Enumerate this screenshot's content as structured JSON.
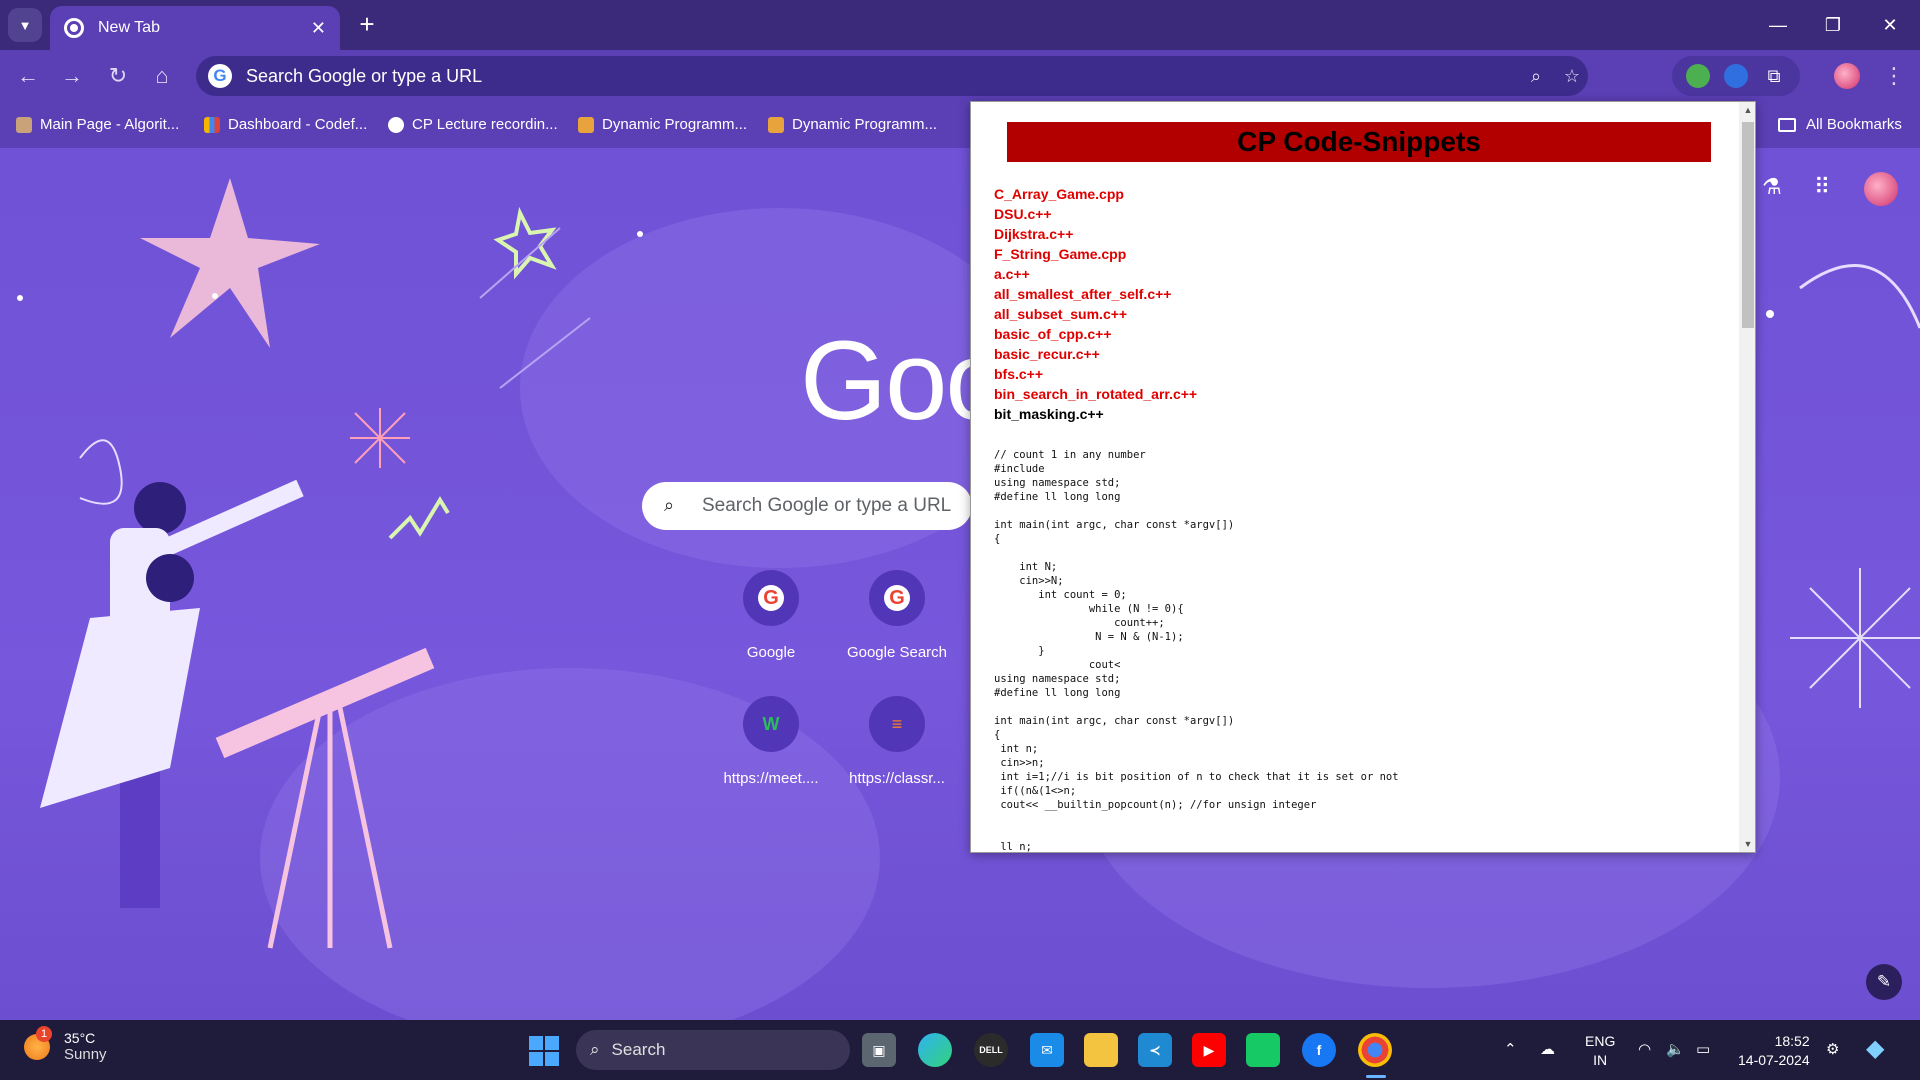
{
  "browser": {
    "tab_title": "New Tab",
    "omnibox_placeholder": "Search Google or type a URL",
    "bookmarks": [
      "Main Page - Algorit...",
      "Dashboard - Codef...",
      "CP Lecture recordin...",
      "Dynamic Programm...",
      "Dynamic Programm..."
    ],
    "all_bookmarks": "All Bookmarks"
  },
  "ntp": {
    "logo_text": "Goo",
    "search_placeholder": "Search Google or type a URL",
    "shortcuts": [
      {
        "label": "Google",
        "icon": "google-icon"
      },
      {
        "label": "Google Search",
        "icon": "google-icon"
      },
      {
        "label": "https://meet....",
        "icon": "w-icon"
      },
      {
        "label": "https://classr...",
        "icon": "stackoverflow-icon"
      }
    ]
  },
  "popup": {
    "title": "CP Code-Snippets",
    "files": [
      "C_Array_Game.cpp",
      "DSU.c++",
      "Dijkstra.c++",
      "F_String_Game.cpp",
      "a.c++",
      "all_smallest_after_self.c++",
      "all_subset_sum.c++",
      "basic_of_cpp.c++",
      "basic_recur.c++",
      "bfs.c++",
      "bin_search_in_rotated_arr.c++",
      "bit_masking.c++"
    ],
    "active_file": "bit_masking.c++",
    "code": "// count 1 in any number\n#include\nusing namespace std;\n#define ll long long\n\nint main(int argc, char const *argv[])\n{\n\n    int N;\n    cin>>N;\n       int count = 0;\n               while (N != 0){\n                   count++;\n                N = N & (N-1);\n       }\n               cout<\nusing namespace std;\n#define ll long long\n\nint main(int argc, char const *argv[])\n{\n int n;\n cin>>n;\n int i=1;//i is bit position of n to check that it is set or not\n if((n&(1<>n;\n cout<< __builtin_popcount(n); //for unsign integer\n\n\n ll n;"
  },
  "taskbar": {
    "weather_badge": "1",
    "temperature": "35°C",
    "condition": "Sunny",
    "search_label": "Search",
    "language_top": "ENG",
    "language_bottom": "IN",
    "time": "18:52",
    "date": "14-07-2024"
  },
  "colors": {
    "titlebar": "#3b2a7a",
    "toolbar": "#5a3fb5",
    "ntp_background": "#7757dc",
    "popup_header": "#b20000",
    "file_link": "#e00000",
    "taskbar": "#1f1b3a"
  }
}
